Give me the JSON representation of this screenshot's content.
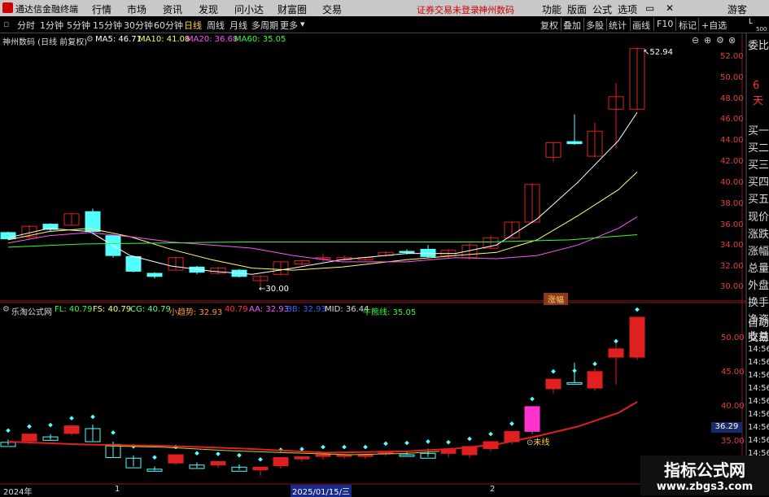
{
  "titlebar": {
    "app_name": "通达信金融终端",
    "menus": [
      "行情",
      "市场",
      "资讯",
      "发现",
      "问小达",
      "财富圈",
      "交易"
    ],
    "notice": "证券交易未登录",
    "stock": "神州数码",
    "right_menus": [
      "功能",
      "版面",
      "公式",
      "选项"
    ],
    "user": "游客"
  },
  "toolbar": {
    "periods": [
      "分时",
      "1分钟",
      "5分钟",
      "15分钟",
      "30分钟",
      "60分钟",
      "日线",
      "周线",
      "月线",
      "多周期",
      "更多"
    ],
    "selected_period": "日线",
    "buttons": [
      "复权",
      "叠加",
      "多股",
      "统计",
      "画线",
      "F10",
      "标记",
      "+自选"
    ]
  },
  "main": {
    "stock_label": "神州数码 (日线 前复权)",
    "ma5": "MA5: 46.71",
    "ma10": "MA10: 41.08",
    "ma20": "MA20: 36.68",
    "ma60": "MA60: 35.05",
    "high_label": "52.94",
    "low_label": "30.00",
    "badge": "涨幅",
    "axis": [
      "52.00",
      "50.00",
      "48.00",
      "46.00",
      "44.00",
      "42.00",
      "40.00",
      "38.00",
      "36.00",
      "34.00",
      "32.00",
      "30.00"
    ]
  },
  "sub": {
    "label": "乐淘公式网",
    "fl": "FL: 40.79",
    "fs": "FS: 40.79",
    "cg": "CG: 40.79",
    "trend": "小趋势: 32.93",
    "v": "40.79",
    "aa": "AA: 32.93",
    "bb": "BB: 32.93",
    "mid": "MID: 36.44",
    "bull": "牛熊线: 35.05",
    "annot": "未线",
    "axis": [
      "50.00",
      "45.00",
      "40.00",
      "35.00"
    ],
    "price_tag": "36.29",
    "times": [
      "14:56",
      "14:56",
      "14:56",
      "14:56",
      "14:56",
      "14:56",
      "14:56",
      "14:56",
      "14:56"
    ]
  },
  "right_panel": {
    "top": [
      "L",
      "500"
    ],
    "items": [
      "委比",
      "6天",
      "买一",
      "买二",
      "买三",
      "买四",
      "买五",
      "现价",
      "涨跌",
      "涨幅",
      "总量",
      "外盘",
      "换手",
      "净资",
      "收益"
    ],
    "auto": [
      "自动",
      "交易"
    ]
  },
  "bottom": {
    "dates": [
      "2024年",
      "1",
      "2025/01/15/三",
      "2"
    ]
  },
  "watermark": {
    "line1": "指标公式网",
    "line2": "www.zbgs3.com"
  },
  "colors": {
    "up": "#e02020",
    "down": "#54ffff",
    "ma5": "#ffffff",
    "ma10": "#ffff66",
    "ma20": "#ff55ff",
    "ma60": "#33ff33"
  }
}
